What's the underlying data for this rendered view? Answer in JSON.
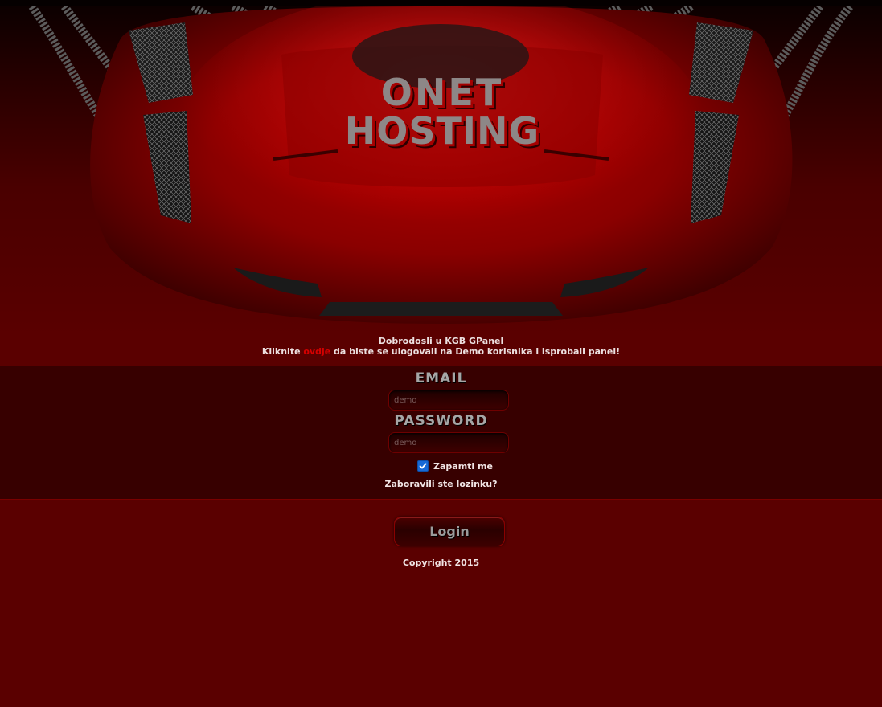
{
  "header": {
    "logo_line1": "ONET",
    "logo_line2": "HOSTING"
  },
  "welcome": {
    "line1": "Dobrodosli u KGB GPanel",
    "line2_before": "Kliknite ",
    "line2_link": "ovdje",
    "line2_after": " da biste se ulogovali na Demo korisnika i isprobali panel!"
  },
  "form": {
    "email_label": "EMAIL",
    "email_placeholder": "demo",
    "password_label": "PASSWORD",
    "password_placeholder": "demo",
    "remember_label": "Zapamti me",
    "remember_checked": true,
    "forgot_link": "Zaboravili ste lozinku?",
    "login_button": "Login"
  },
  "footer": {
    "copyright": "Copyright 2015"
  },
  "colors": {
    "page_background": "#5a0000",
    "band_background": "#370000",
    "link_red": "#d40000",
    "checkbox_blue": "#1769d6"
  },
  "icons": {
    "checkbox": "checkmark-icon"
  }
}
